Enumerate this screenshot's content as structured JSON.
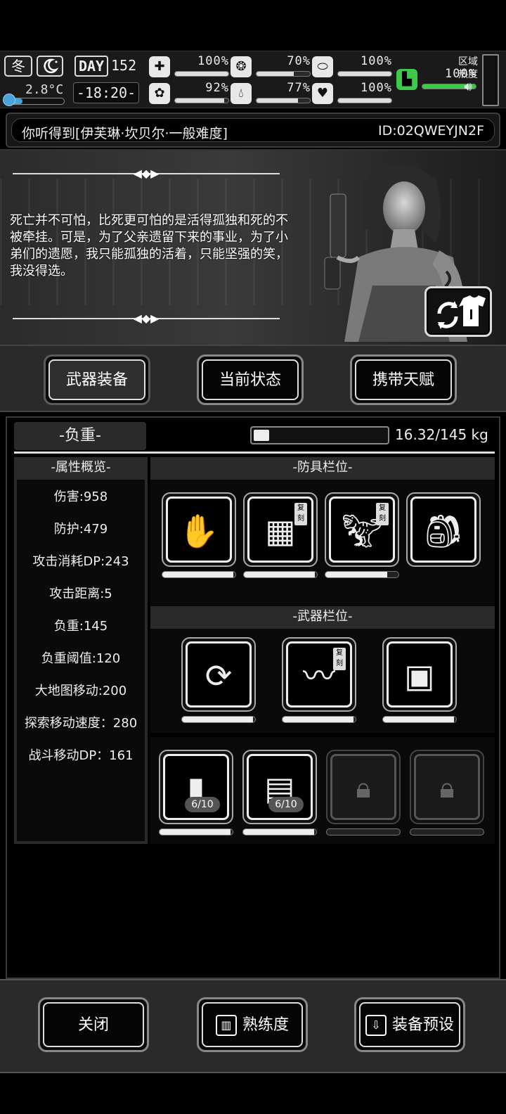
{
  "status": {
    "season": "冬",
    "temperature": "2.8°C",
    "temperature_level": 0.3,
    "day_label": "DAY",
    "day_number": "152",
    "clock": "-18:20-",
    "stats": [
      {
        "id": "health",
        "icon": "medkit-icon",
        "value": "100%",
        "level": 1.0
      },
      {
        "id": "hunger",
        "icon": "stomach-icon",
        "value": "70%",
        "level": 0.7
      },
      {
        "id": "pill",
        "icon": "pill-icon",
        "value": "100%",
        "level": 1.0
      },
      {
        "id": "sanity",
        "icon": "brain-icon",
        "value": "92%",
        "level": 0.92
      },
      {
        "id": "thirst",
        "icon": "water-drop-icon",
        "value": "77%",
        "level": 0.77
      },
      {
        "id": "mood",
        "icon": "heart-icon",
        "value": "100%",
        "level": 1.0
      },
      {
        "id": "stamina",
        "icon": "boot-icon",
        "value": "100%",
        "level": 1.0
      }
    ],
    "region_label_1": "区域",
    "region_label_2": "热度"
  },
  "header": {
    "title": "你听得到[伊芙琳·坎贝尔·一般难度]",
    "id": "ID:02QWEYJN2F"
  },
  "character": {
    "quote": "死亡并不可怕，比死更可怕的是活得孤独和死的不被牵挂。可是，为了父亲遗留下来的事业，为了小弟们的遗愿，我只能孤独的活着，只能坚强的笑，我没得选。"
  },
  "tabs": [
    {
      "label": "武器装备",
      "active": true
    },
    {
      "label": "当前状态",
      "active": false
    },
    {
      "label": "携带天赋",
      "active": false
    }
  ],
  "weight": {
    "label": "-负重-",
    "text": "16.32/145 kg",
    "current": 16.32,
    "max": 145
  },
  "attributes": {
    "header": "-属性概览-",
    "items": [
      "伤害:958",
      "防护:479",
      "攻击消耗DP:243",
      "攻击距离:5",
      "负重:145",
      "负重阈值:120",
      "大地图移动:200",
      "探索移动速度：280",
      "战斗移动DP：161"
    ]
  },
  "armor": {
    "header": "-防具栏位-",
    "slots": [
      {
        "name": "gloves",
        "icon": "gloves-icon",
        "durability": 0.97,
        "tag": ""
      },
      {
        "name": "shorts",
        "icon": "shorts-icon",
        "durability": 0.97,
        "tag": "复刻"
      },
      {
        "name": "dino-head",
        "icon": "dinosaur-head-icon",
        "durability": 0.85,
        "tag": "复刻"
      },
      {
        "name": "backpack",
        "icon": "backpack-icon",
        "durability": null,
        "tag": ""
      }
    ]
  },
  "weapons": {
    "header": "-武器栏位-",
    "slots": [
      {
        "name": "chain-whip",
        "icon": "chain-whip-icon",
        "durability": 0.97,
        "tag": ""
      },
      {
        "name": "whip",
        "icon": "whip-icon",
        "durability": 0.97,
        "tag": "复刻"
      },
      {
        "name": "shield-box",
        "icon": "box-shield-icon",
        "durability": 0.97,
        "tag": ""
      }
    ]
  },
  "consumables": {
    "slots": [
      {
        "name": "grenade",
        "icon": "grenade-icon",
        "count": "6/10",
        "durability": 0.97,
        "locked": false
      },
      {
        "name": "crate",
        "icon": "crate-icon",
        "count": "6/10",
        "durability": 0.97,
        "locked": false
      },
      {
        "name": "locked-1",
        "icon": "lock-icon",
        "count": "",
        "durability": 0,
        "locked": true
      },
      {
        "name": "locked-2",
        "icon": "lock-icon",
        "count": "",
        "durability": 0,
        "locked": true
      }
    ]
  },
  "bottom": {
    "close": "关闭",
    "proficiency": "熟练度",
    "preset": "装备预设"
  }
}
